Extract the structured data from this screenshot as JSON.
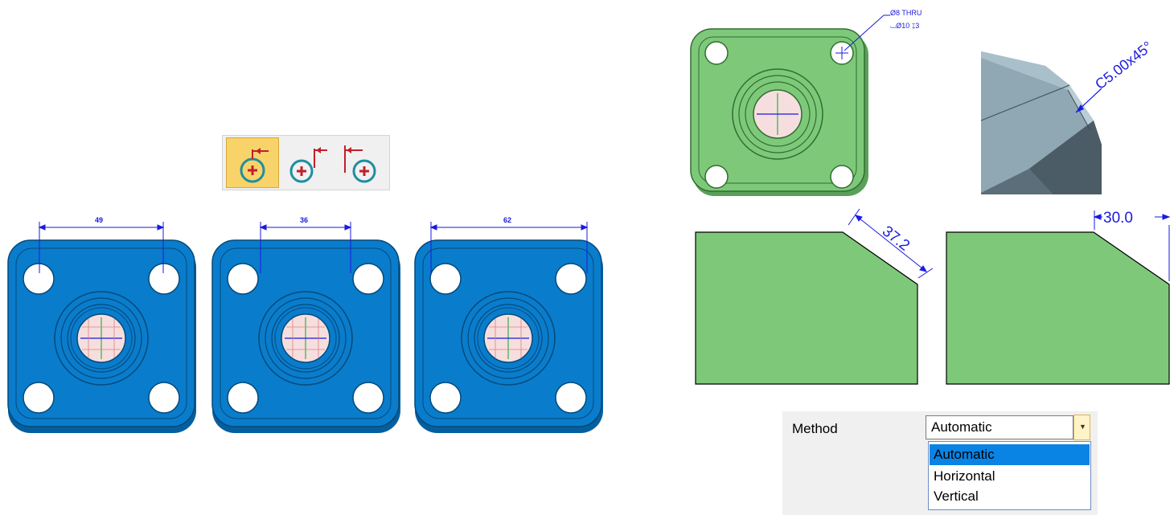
{
  "toolbar": {
    "buttons": [
      {
        "name": "dimension-left-button",
        "selected": true
      },
      {
        "name": "dimension-center-button",
        "selected": false
      },
      {
        "name": "dimension-right-button",
        "selected": false
      }
    ]
  },
  "flanges": {
    "dims": [
      "49",
      "36",
      "62"
    ]
  },
  "hole_callout": {
    "line1": "Ø8  THRU",
    "line2": "⌴Ø10  ↧3"
  },
  "chamfer_3d": {
    "label": "C5.00x45°"
  },
  "chamfer_views": {
    "aligned_dim": "37.2",
    "horizontal_dim": "30.0"
  },
  "method_panel": {
    "label": "Method",
    "selected": "Automatic",
    "options": [
      "Automatic",
      "Horizontal",
      "Vertical"
    ],
    "highlighted_index": 0
  },
  "colors": {
    "flange_blue": "#0a7ccc",
    "green": "#7ec87a",
    "dim_blue": "#1a1ae0",
    "toolbar_selected": "#f8d36a",
    "highlight": "#0a84e4"
  }
}
